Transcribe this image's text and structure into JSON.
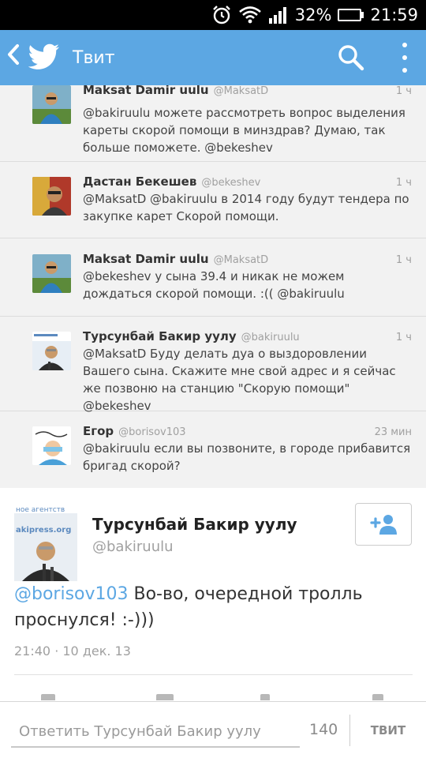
{
  "status_bar": {
    "battery_percent": "32%",
    "battery_level": 0.32,
    "time": "21:59",
    "battery_color": "#48e026",
    "icons": [
      "alarm-icon",
      "wifi-icon",
      "signal-icon",
      "battery-icon"
    ]
  },
  "action_bar": {
    "title": "Твит",
    "color": "#5ca7e3",
    "icons": [
      "back-chevron-icon",
      "twitter-bird-icon",
      "search-icon",
      "overflow-menu-icon"
    ]
  },
  "conversation": [
    {
      "name": "Maksat Damir uulu",
      "handle": "@MaksatD",
      "time": "1 ч",
      "text": "@bakiruulu можете рассмотреть вопрос выделения кареты скорой помощи в минздрав? Думаю, так больше поможете. @bekeshev"
    },
    {
      "name": "Дастан Бекешев",
      "handle": "@bekeshev",
      "time": "1 ч",
      "text": "@MaksatD @bakiruulu в 2014 году будут тендера по закупке карет Скорой помощи."
    },
    {
      "name": "Maksat Damir uulu",
      "handle": "@MaksatD",
      "time": "1 ч",
      "text": "@bekeshev у сына 39.4 и никак не можем дождаться скорой помощи. :(( @bakiruulu"
    },
    {
      "name": "Турсунбай Бакир уулу",
      "handle": "@bakiruulu",
      "time": "1 ч",
      "text": "@MaksatD Буду делать дуа о выздоровлении Вашего сына. Скажите мне свой адрес и я сейчас же позвоню на станцию  \"Скорую помощи\" @bekeshev"
    },
    {
      "name": "Егор",
      "handle": "@borisov103",
      "time": "23 мин",
      "text": "@bakiruulu если вы позвоните, в городе прибавится бригад скорой?"
    }
  ],
  "main_tweet": {
    "name": "Турсунбай Бакир уулу",
    "handle": "@bakiruulu",
    "mention": "@borisov103",
    "text": " Во-во, очередной тролль проснулся! :-)))",
    "date": "21:40 · 10 дек. 13",
    "avatar_banner_lines": [
      "ное агентств",
      "akipress.org"
    ],
    "follow_icon": "add-user-icon"
  },
  "reply_bar": {
    "placeholder": "Ответить Турсунбай Бакир уулу",
    "char_count": "140",
    "send_label": "ТВИТ"
  }
}
